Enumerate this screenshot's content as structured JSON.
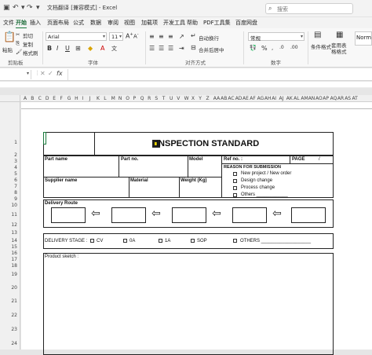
{
  "titlebar": {
    "doc_title": "文档翻译 [兼容模式] - Excel",
    "search_placeholder": "搜索"
  },
  "menu": [
    "文件",
    "开始",
    "插入",
    "页面布局",
    "公式",
    "数据",
    "审阅",
    "视图",
    "加载项",
    "开发工具",
    "帮助",
    "PDF工具集",
    "百度网盘"
  ],
  "active_menu": "开始",
  "ribbon": {
    "clipboard": {
      "paste": "粘贴",
      "cut": "剪切",
      "copy": "复制",
      "format_painter": "格式刷",
      "group": "剪贴板"
    },
    "font": {
      "name": "Arial",
      "size": "11",
      "bold": "B",
      "italic": "I",
      "underline": "U",
      "group": "字体"
    },
    "alignment": {
      "wrap": "自动换行",
      "merge": "合并后居中",
      "group": "对齐方式"
    },
    "number": {
      "format": "常规",
      "group": "数字"
    },
    "styles": {
      "conditional": "条件格式",
      "table": "套用表格格式",
      "normal": "Norm"
    }
  },
  "formula": {
    "namebox": "",
    "fx": "fx"
  },
  "columns": [
    "A",
    "B",
    "C",
    "D",
    "E",
    "F",
    "G",
    "H",
    "I",
    "J",
    "K",
    "L",
    "M",
    "N",
    "O",
    "P",
    "Q",
    "R",
    "S",
    "T",
    "U",
    "V",
    "W",
    "X",
    "Y",
    "Z",
    "AA",
    "AB",
    "AC",
    "AD",
    "AE",
    "AF",
    "AG",
    "AH",
    "AI",
    "AJ",
    "AK",
    "AL",
    "AM",
    "AN",
    "AO",
    "AP",
    "AQ",
    "AR",
    "AS",
    "AT"
  ],
  "rows": [
    "1",
    "2",
    "3",
    "4",
    "5",
    "6",
    "7",
    "8",
    "9",
    "10",
    "11",
    "12",
    "13",
    "14",
    "15",
    "16",
    "17",
    "18",
    "19",
    "20",
    "21",
    "22",
    "23",
    "24"
  ],
  "form": {
    "title": "INSPECTION STANDARD",
    "part_name": "Part name",
    "part_no": "Part no.",
    "model": "Model",
    "ref_no": "Ref no. :",
    "page": "PAGE",
    "page_sep": "/",
    "reason_title": "REASON FOR SUBMISSION",
    "reasons": [
      "New project / New order",
      "Design change",
      "Process change",
      "Others ____________"
    ],
    "supplier_name": "Supplier name",
    "material": "Material",
    "weight": "Weight (Kg)",
    "delivery_route": "Delivery Route",
    "delivery_stage": "DELIVERY STAGE :",
    "stages": [
      "CV",
      "0A",
      "1A",
      "SOP",
      "OTHERS ___________________"
    ],
    "product_sketch": "Product sketch :"
  }
}
